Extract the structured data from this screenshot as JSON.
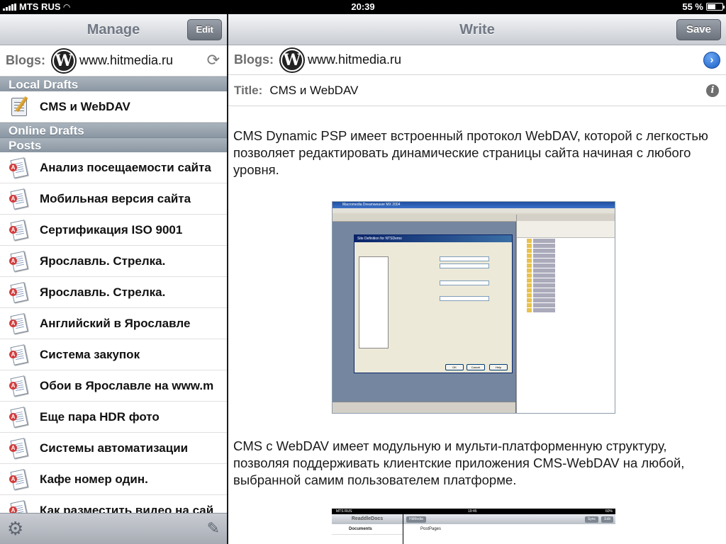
{
  "status_bar": {
    "carrier": "MTS RUS",
    "time": "20:39",
    "battery": "55 %",
    "battery_level": 0.55
  },
  "left_panel": {
    "title": "Manage",
    "edit_label": "Edit",
    "blogs_label": "Blogs:",
    "blog_url": "www.hitmedia.ru",
    "sections": {
      "local_drafts": "Local Drafts",
      "online_drafts": "Online Drafts",
      "posts": "Posts"
    },
    "local_drafts": [
      "CMS и WebDAV"
    ],
    "posts": [
      "Анализ посещаемости сайта",
      "Мобильная версия сайта",
      "Сертификация ISO 9001",
      "Ярославль. Стрелка.",
      "Ярославль. Стрелка.",
      "Английский в Ярославле",
      "Система закупок",
      "Обои в Ярославле на www.m",
      "Еще пара HDR фото",
      "Системы автоматизации",
      "Кафе номер один.",
      "Как разместить видео на сай"
    ]
  },
  "right_panel": {
    "title": "Write",
    "save_label": "Save",
    "blogs_label": "Blogs:",
    "blog_url": "www.hitmedia.ru",
    "title_label": "Title:",
    "title_value": "CMS и WebDAV",
    "paragraph_1": "CMS Dynamic PSP имеет встроенный протокол WebDAV, которой с легкостью позволяет редактировать динамические страницы сайта начиная с любого уровня.",
    "paragraph_2": "CMS с WebDAV имеет модульную и мульти-платформенную структуру, позволяя поддерживать клиентские приложения CMS-WebDAV  на любой, выбранной самим пользователем платформе.",
    "image_1": {
      "window_title": "Macromedia Dreamweaver MX 2004",
      "dialog_title": "Site Definition for NTSDemo",
      "ok": "OK",
      "cancel": "Cancel",
      "help": "Help"
    },
    "image_2": {
      "carrier": "MTS RUS",
      "time": "19:45",
      "battery": "60%",
      "app_title": "ReaddleDocs",
      "documents": "Documents",
      "folder_button": "HitMedia",
      "postpages": "PostPages",
      "sync": "Sync",
      "edit": "Edit"
    }
  }
}
